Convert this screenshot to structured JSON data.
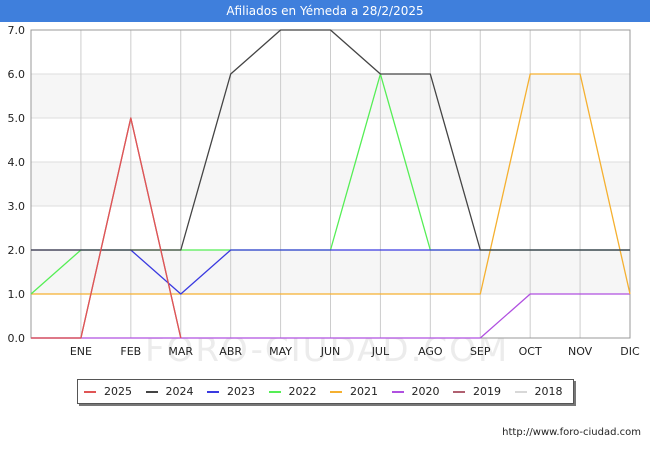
{
  "title": "Afiliados en Yémeda a 28/2/2025",
  "source": "http://www.foro-ciudad.com",
  "watermark": "FORO-CIUDAD.COM",
  "chart_data": {
    "type": "line",
    "title": "Afiliados en Yémeda a 28/2/2025",
    "xlabel": "",
    "ylabel": "",
    "categories": [
      "",
      "ENE",
      "FEB",
      "MAR",
      "ABR",
      "MAY",
      "JUN",
      "JUL",
      "AGO",
      "SEP",
      "OCT",
      "NOV",
      "DIC"
    ],
    "ylim": [
      0,
      7
    ],
    "yticks": [
      "0.0",
      "1.0",
      "2.0",
      "3.0",
      "4.0",
      "5.0",
      "6.0",
      "7.0"
    ],
    "grid": true,
    "legend_position": "bottom",
    "series": [
      {
        "name": "2025",
        "color": "#e05555",
        "values": [
          0,
          0,
          5,
          0,
          null,
          null,
          null,
          null,
          null,
          null,
          null,
          null,
          null
        ]
      },
      {
        "name": "2024",
        "color": "#444444",
        "values": [
          2,
          2,
          2,
          2,
          6,
          7,
          7,
          6,
          6,
          2,
          2,
          2,
          2
        ]
      },
      {
        "name": "2023",
        "color": "#3a3ae0",
        "values": [
          2,
          2,
          2,
          1,
          2,
          2,
          2,
          2,
          2,
          2,
          2,
          2,
          2
        ]
      },
      {
        "name": "2022",
        "color": "#55ee55",
        "values": [
          1,
          2,
          2,
          2,
          2,
          2,
          2,
          6,
          2,
          2,
          2,
          2,
          2
        ]
      },
      {
        "name": "2021",
        "color": "#f5b030",
        "values": [
          1,
          1,
          1,
          1,
          1,
          1,
          1,
          1,
          1,
          1,
          6,
          6,
          1
        ]
      },
      {
        "name": "2020",
        "color": "#b050e0",
        "values": [
          0,
          0,
          0,
          0,
          0,
          0,
          0,
          0,
          0,
          0,
          1,
          1,
          1
        ]
      },
      {
        "name": "2019",
        "color": "#b06070",
        "values": [
          0,
          0,
          5,
          0,
          null,
          null,
          null,
          null,
          null,
          null,
          null,
          null,
          null
        ]
      },
      {
        "name": "2018",
        "color": "#d8d8d8",
        "values": []
      }
    ]
  }
}
